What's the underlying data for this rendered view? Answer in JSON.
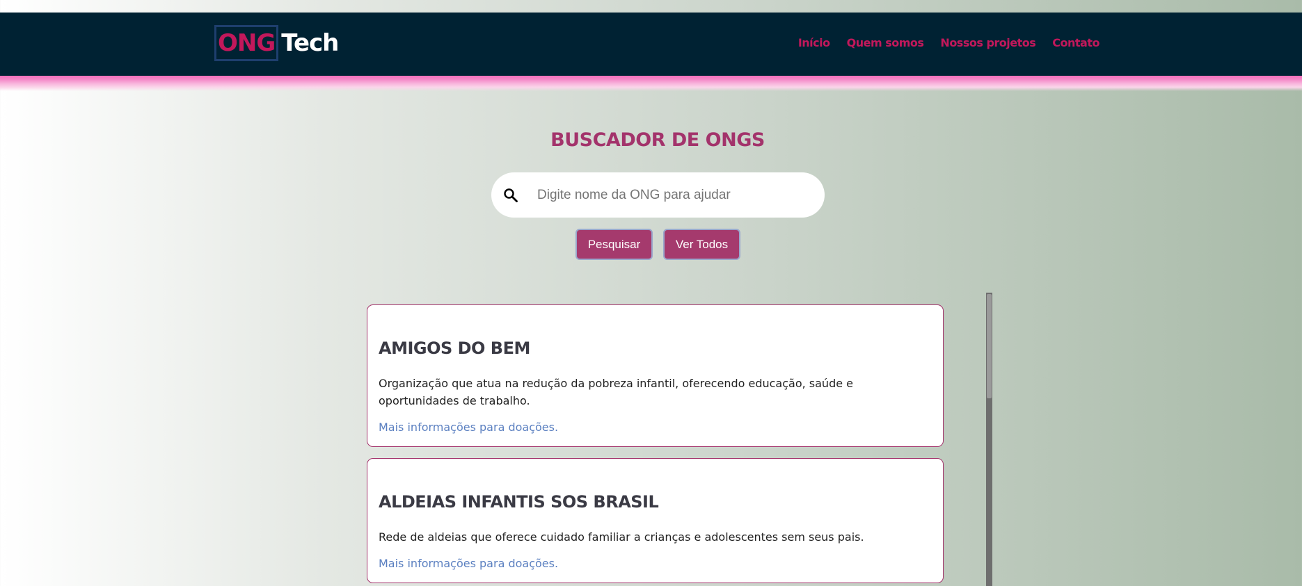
{
  "header": {
    "logo": {
      "part1": "ONG",
      "part2": "Tech"
    },
    "nav": [
      "Início",
      "Quem somos",
      "Nossos projetos",
      "Contato"
    ]
  },
  "main": {
    "title": "BUSCADOR DE ONGS",
    "search": {
      "placeholder": "Digite nome da ONG para ajudar",
      "icon": "search-icon"
    },
    "buttons": {
      "search": "Pesquisar",
      "view_all": "Ver Todos"
    },
    "cards": [
      {
        "name": "AMIGOS DO BEM",
        "description": "Organização que atua na redução da pobreza infantil, oferecendo educação, saúde e oportunidades de trabalho.",
        "link": "Mais informações para doações."
      },
      {
        "name": "ALDEIAS INFANTIS SOS BRASIL",
        "description": "Rede de aldeias que oferece cuidado familiar a crianças e adolescentes sem seus pais.",
        "link": "Mais informações para doações."
      }
    ]
  },
  "colors": {
    "header_bg": "#002233",
    "accent": "#c2185b",
    "button_bg": "#a53a6d",
    "title": "#a3336b",
    "link": "#5a7fc0"
  }
}
